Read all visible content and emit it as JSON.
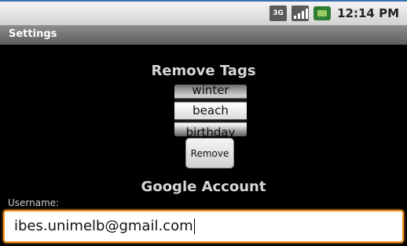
{
  "status_bar": {
    "network_label": "3G",
    "time": "12:14 PM",
    "icons": [
      "network-3g-icon",
      "signal-strength-icon",
      "battery-icon"
    ]
  },
  "title_bar": {
    "title": "Settings"
  },
  "remove_tags": {
    "heading": "Remove Tags",
    "picker_items": [
      "winter",
      "beach",
      "birthday"
    ],
    "selected": "beach",
    "button_label": "Remove"
  },
  "google_account": {
    "heading": "Google Account",
    "username_label": "Username:",
    "username_value": "ibes.unimelb@gmail.com"
  },
  "colors": {
    "focus_accent": "#f7931e",
    "battery": "#2e7d32",
    "background": "#000000"
  }
}
